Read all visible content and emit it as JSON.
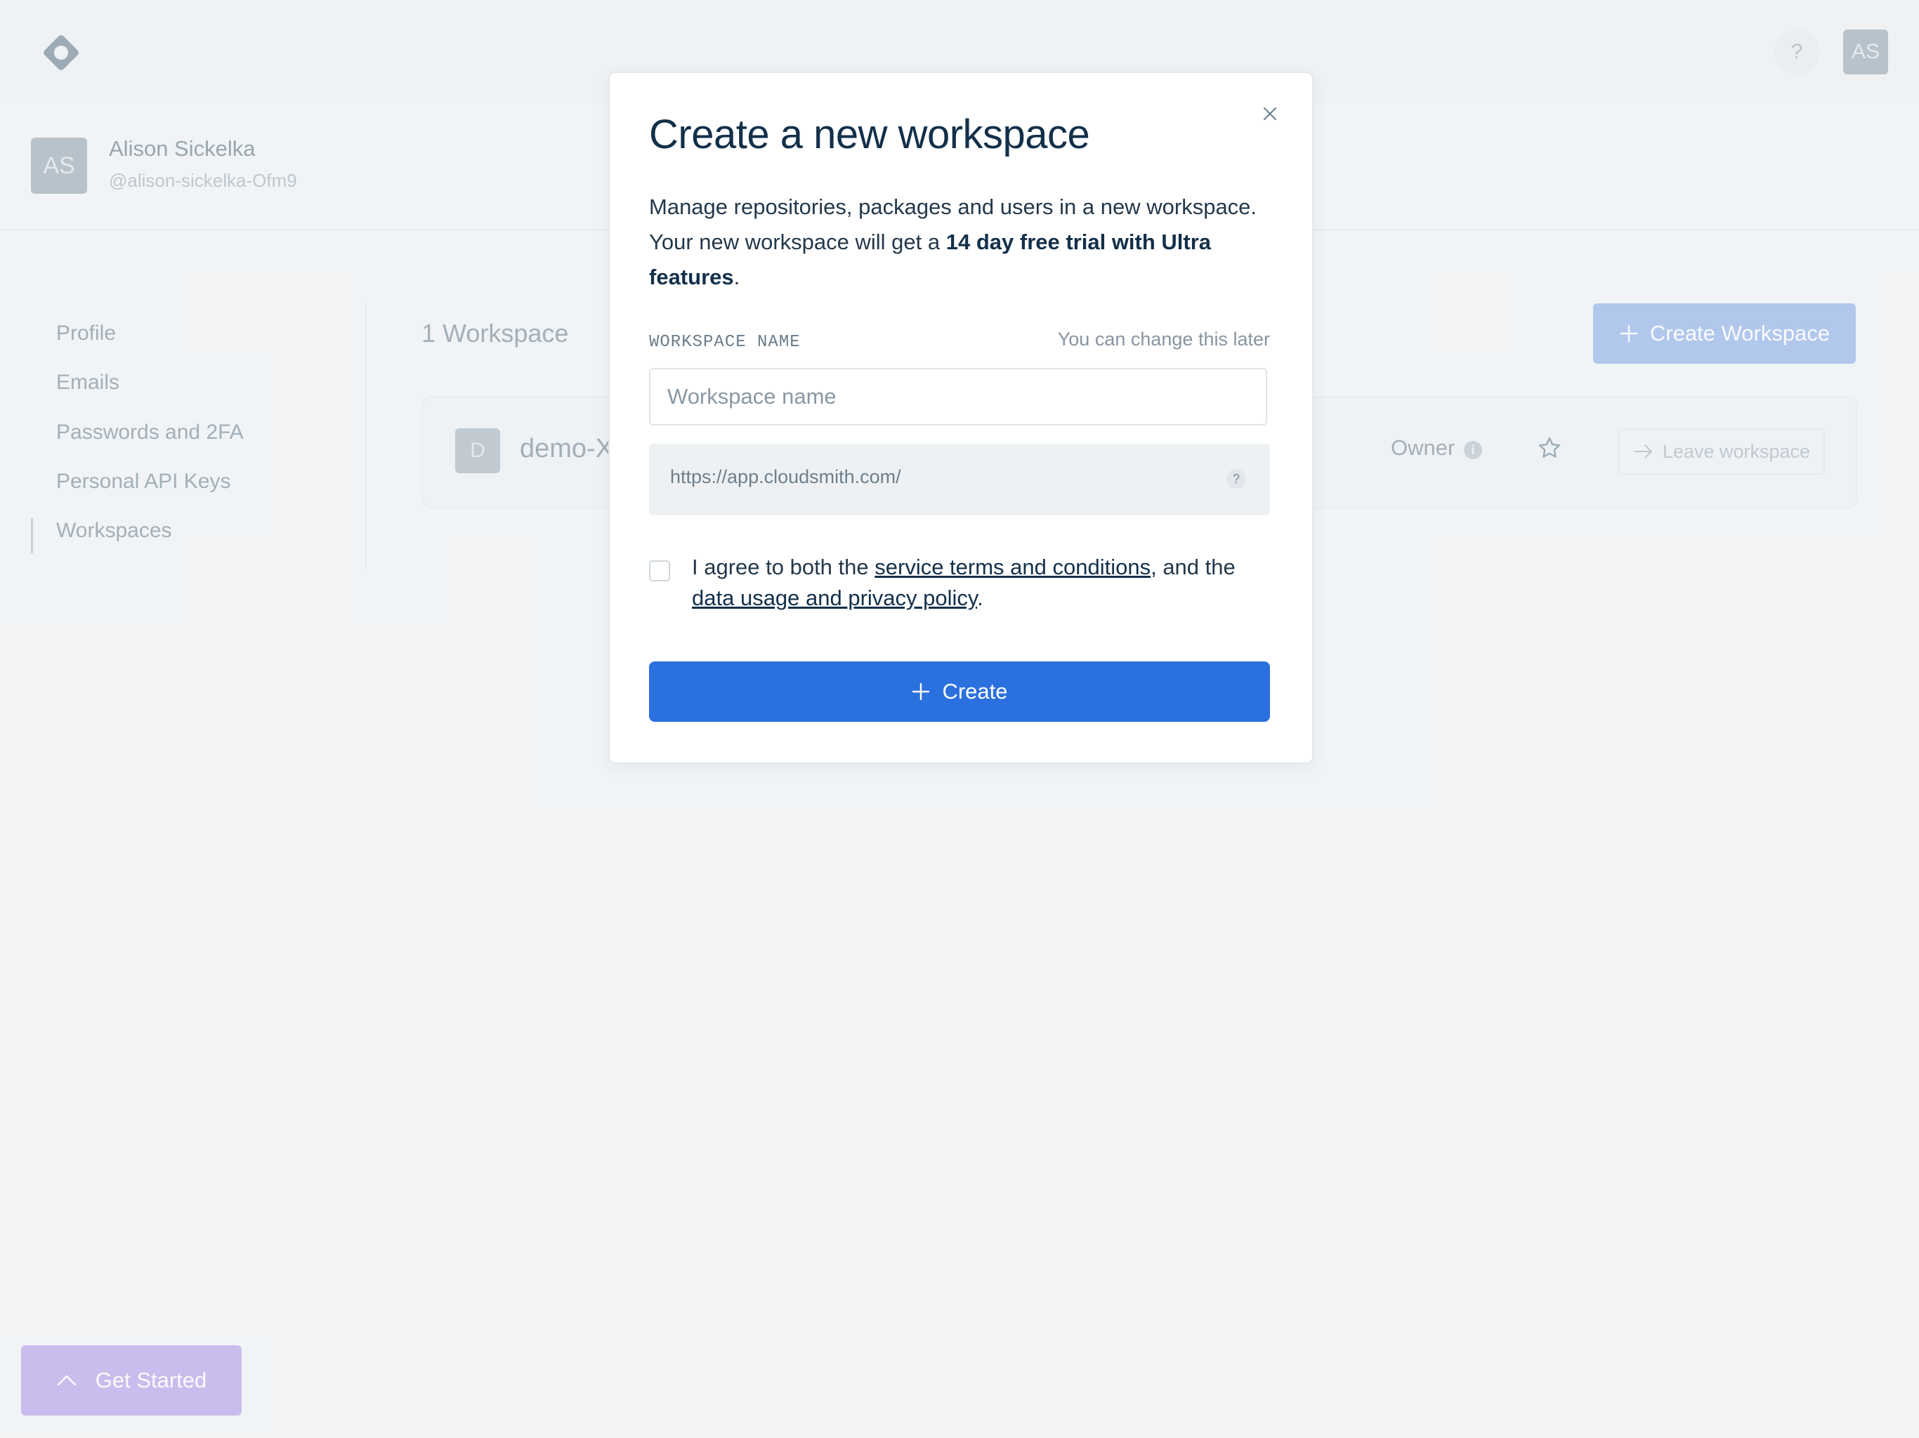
{
  "colors": {
    "primary": "#2b70df",
    "primary_muted": "#8fb0e6",
    "get_started": "#b59ee6",
    "page_bg": "#f2f4f6"
  },
  "header": {
    "logo_icon": "cloudsmith-logo-icon",
    "help_label": "?",
    "avatar_initials": "AS"
  },
  "user": {
    "initials": "AS",
    "name": "Alison Sickelka",
    "handle": "@alison-sickelka-Ofm9"
  },
  "sidebar": {
    "items": [
      {
        "label": "Profile"
      },
      {
        "label": "Emails"
      },
      {
        "label": "Passwords and 2FA"
      },
      {
        "label": "Personal API Keys"
      },
      {
        "label": "Workspaces",
        "active": true
      }
    ]
  },
  "workspaces": {
    "count_label": "1 Workspace",
    "create_label": "Create Workspace",
    "items": [
      {
        "initial": "D",
        "name": "demo-X",
        "role": "Owner",
        "role_info": "i",
        "leave_label": "Leave workspace"
      }
    ]
  },
  "get_started": {
    "label": "Get Started"
  },
  "modal": {
    "title": "Create a new workspace",
    "desc_line1": "Manage repositories, packages and users in a new workspace.",
    "desc_line2_pre": "Your new workspace will get a ",
    "desc_line2_bold": "14 day free trial with Ultra features",
    "desc_line2_post": ".",
    "field_label": "WORKSPACE NAME",
    "field_hint": "You can change this later",
    "name_placeholder": "Workspace name",
    "name_value": "",
    "url_prefix": "https://app.cloudsmith.com/",
    "url_help": "?",
    "agree_pre": "I agree to both the ",
    "agree_link1": "service terms and conditions",
    "agree_mid": ", and the ",
    "agree_link2": "data usage and privacy policy",
    "agree_post": ".",
    "agree_checked": false,
    "create_label": "Create"
  }
}
